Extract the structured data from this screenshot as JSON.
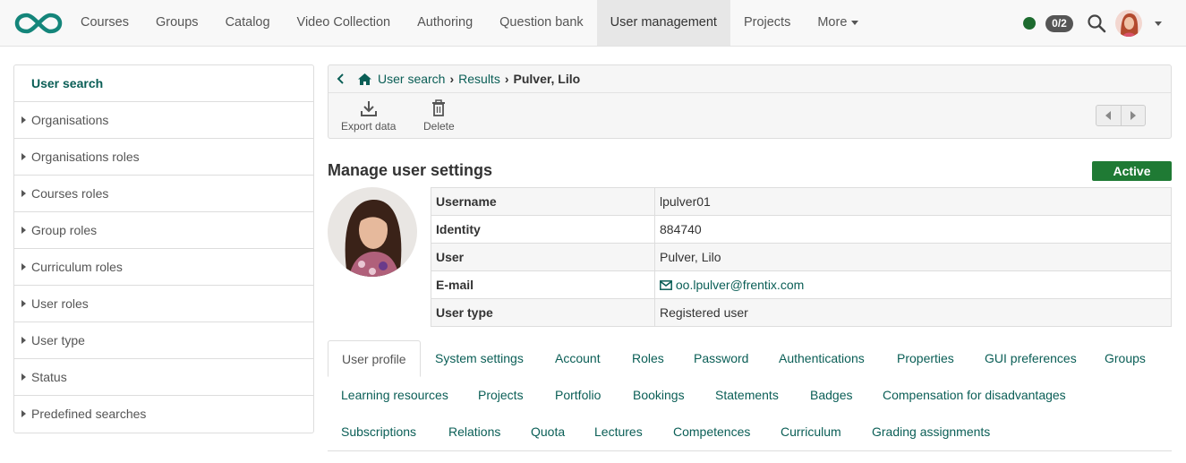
{
  "nav": {
    "items": [
      {
        "label": "Courses"
      },
      {
        "label": "Groups"
      },
      {
        "label": "Catalog"
      },
      {
        "label": "Video Collection"
      },
      {
        "label": "Authoring"
      },
      {
        "label": "Question bank"
      },
      {
        "label": "User management",
        "active": true
      },
      {
        "label": "Projects"
      },
      {
        "label": "More"
      }
    ],
    "notifications": "0/2",
    "status_color": "#1d6b2f"
  },
  "sidebar": {
    "items": [
      {
        "label": "User search",
        "active": true
      },
      {
        "label": "Organisations"
      },
      {
        "label": "Organisations roles"
      },
      {
        "label": "Courses roles"
      },
      {
        "label": "Group roles"
      },
      {
        "label": "Curriculum roles"
      },
      {
        "label": "User roles"
      },
      {
        "label": "User type"
      },
      {
        "label": "Status"
      },
      {
        "label": "Predefined searches"
      }
    ]
  },
  "breadcrumb": {
    "items": [
      "User search",
      "Results"
    ],
    "current": "Pulver, Lilo"
  },
  "toolbar": {
    "export_label": "Export data",
    "delete_label": "Delete"
  },
  "manage": {
    "title": "Manage user settings",
    "status": "Active",
    "status_color": "#1f7a34",
    "fields": [
      {
        "key": "Username",
        "value": "lpulver01"
      },
      {
        "key": "Identity",
        "value": "884740"
      },
      {
        "key": "User",
        "value": "Pulver, Lilo"
      },
      {
        "key": "E-mail",
        "value": "oo.lpulver@frentix.com"
      },
      {
        "key": "User type",
        "value": "Registered user"
      }
    ]
  },
  "tabs": [
    "User profile",
    "System settings",
    "Account",
    "Roles",
    "Password",
    "Authentications",
    "Properties",
    "GUI preferences",
    "Groups",
    "Learning resources",
    "Projects",
    "Portfolio",
    "Bookings",
    "Statements",
    "Badges",
    "Compensation for disadvantages",
    "Subscriptions",
    "Relations",
    "Quota",
    "Lectures",
    "Competences",
    "Curriculum",
    "Grading assignments"
  ],
  "accent_color": "#0a5e56"
}
